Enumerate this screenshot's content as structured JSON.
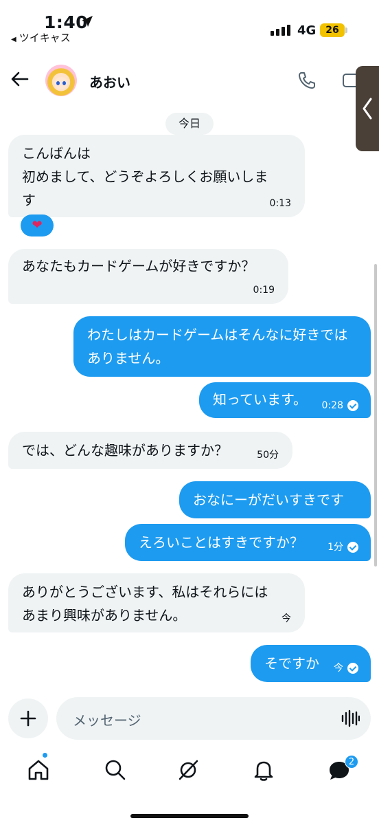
{
  "status_bar": {
    "time": "1:40",
    "back_app": "ツイキャス",
    "network": "4G",
    "battery": "26"
  },
  "header": {
    "contact_name": "あおい"
  },
  "conversation": {
    "date_label": "今日",
    "messages": [
      {
        "direction": "incoming",
        "text": "こんばんは\n初めまして、どうぞよろしくお願いしま\nす",
        "time": "0:13"
      },
      {
        "direction": "incoming",
        "text": "あなたもカードゲームが好きですか？",
        "time": "0:19"
      },
      {
        "direction": "outgoing",
        "text": "わたしはカードゲームはそんなに好きでは\nありません。",
        "time": ""
      },
      {
        "direction": "outgoing",
        "text": "知っています。",
        "time": "0:28"
      },
      {
        "direction": "incoming",
        "text": "では、どんな趣味がありますか？",
        "time": "50分"
      },
      {
        "direction": "outgoing",
        "text": "おなにーがだいすきです",
        "time": ""
      },
      {
        "direction": "outgoing",
        "text": "えろいことはすきですか？",
        "time": "1分"
      },
      {
        "direction": "incoming",
        "text": "ありがとうございます、私はそれらには\nあまり興味がありません。",
        "time": "今"
      },
      {
        "direction": "outgoing",
        "text": "そですか",
        "time": "今"
      }
    ],
    "reaction": "❤"
  },
  "composer": {
    "placeholder": "メッセージ"
  },
  "nav": {
    "messages_badge": "2"
  },
  "colors": {
    "accent": "#1d9bf0",
    "incoming_bubble": "#eff3f4",
    "text": "#0f1419"
  }
}
